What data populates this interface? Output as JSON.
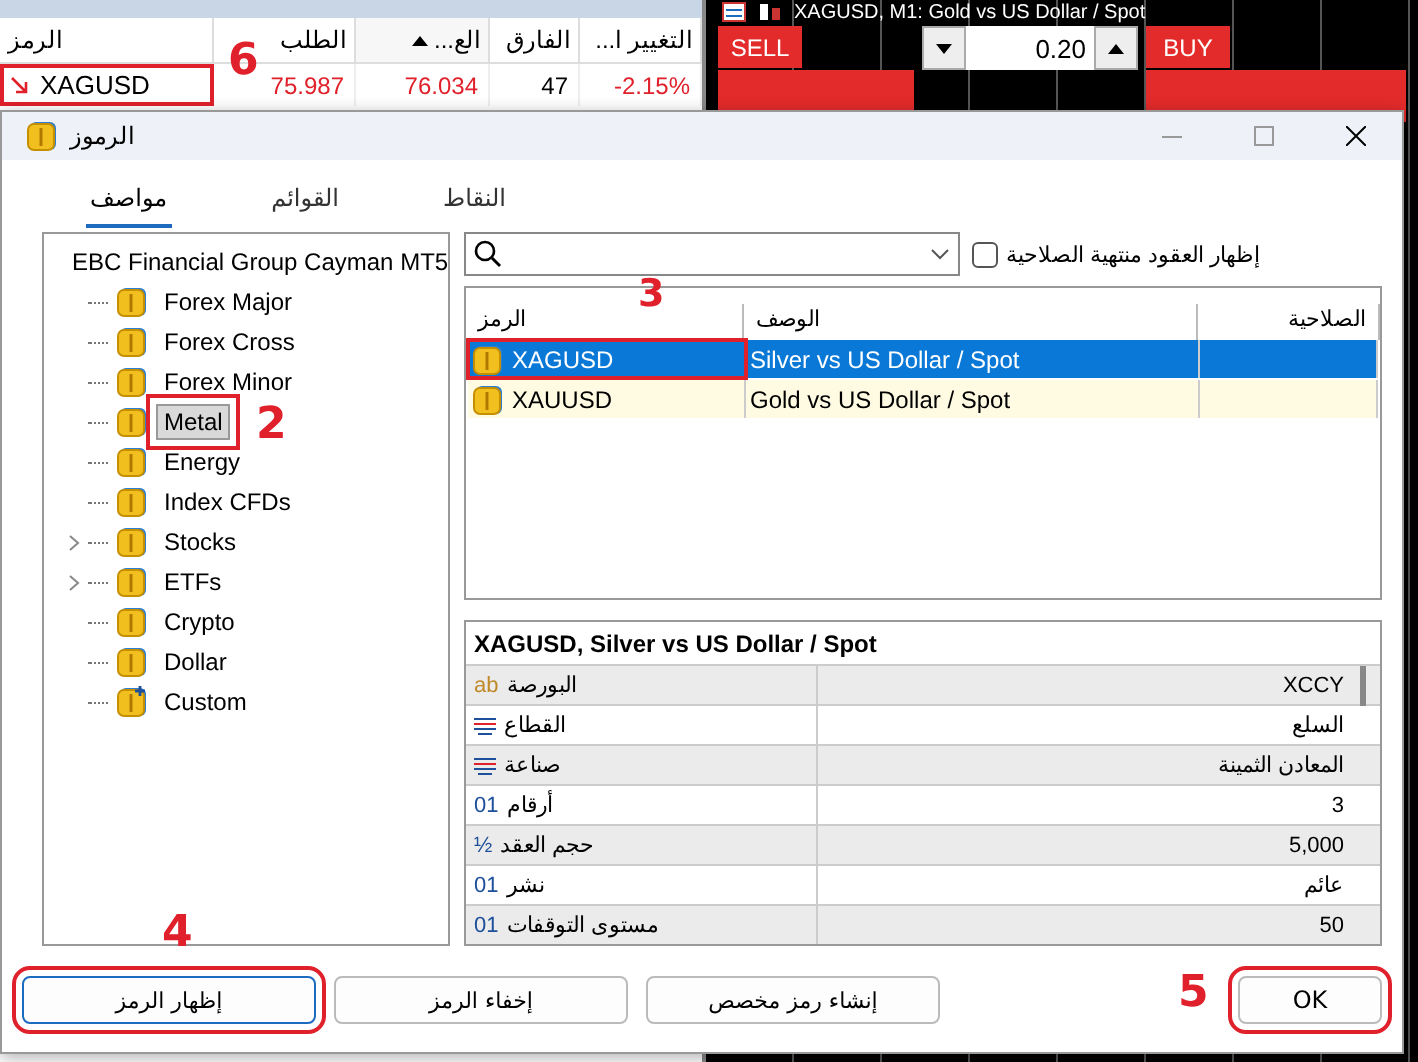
{
  "market_watch": {
    "columns": [
      {
        "label": "...التغيير ا",
        "sorted": false
      },
      {
        "label": "الفارق",
        "sorted": false
      },
      {
        "label": "...الع",
        "sorted": true
      },
      {
        "label": "الطلب",
        "sorted": false
      },
      {
        "label": "الرمز",
        "sorted": false
      }
    ],
    "rows": [
      {
        "symbol": "XAGUSD",
        "falling": true,
        "bid": "75.987",
        "ask": "76.034",
        "spread": "47",
        "change": "-2.15%",
        "callout": "6"
      }
    ]
  },
  "chart": {
    "title": "XAGUSD, M1:  Gold vs US Dollar / Spot",
    "sell": "SELL",
    "buy": "BUY",
    "volume": "0.20"
  },
  "dialog": {
    "title": "الرموز",
    "tabs": [
      {
        "label": "النقاط",
        "selected": false
      },
      {
        "label": "القوائم",
        "selected": false
      },
      {
        "label": "مواصف",
        "selected": true
      }
    ],
    "tree": {
      "label": "EBC Financial Group Cayman MT5",
      "children": [
        {
          "label": "Forex Major",
          "kind": "symbol",
          "collapsed": false,
          "selected": false
        },
        {
          "label": "Forex Cross",
          "kind": "symbol",
          "collapsed": false,
          "selected": false
        },
        {
          "label": "Forex Minor",
          "kind": "symbol",
          "collapsed": false,
          "selected": false
        },
        {
          "label": "Metal",
          "kind": "symbol",
          "collapsed": false,
          "selected": true,
          "callout": "2"
        },
        {
          "label": "Energy",
          "kind": "symbol",
          "collapsed": false,
          "selected": false
        },
        {
          "label": "Index CFDs",
          "kind": "symbol",
          "collapsed": false,
          "selected": false
        },
        {
          "label": "Stocks",
          "kind": "symbol",
          "collapsed": true,
          "selected": false
        },
        {
          "label": "ETFs",
          "kind": "symbol",
          "collapsed": true,
          "selected": false
        },
        {
          "label": "Crypto",
          "kind": "symbol",
          "collapsed": false,
          "selected": false
        },
        {
          "label": "Dollar",
          "kind": "symbol",
          "collapsed": false,
          "selected": false
        },
        {
          "label": "Custom",
          "kind": "custom",
          "collapsed": false,
          "selected": false
        }
      ]
    },
    "expired_checkbox": {
      "label": "إظهار العقود منتهية الصلاحية",
      "checked": false
    },
    "table": {
      "columns": [
        "الصلاحية",
        "الوصف",
        "الرمز"
      ],
      "callout": "3",
      "rows": [
        {
          "symbol": "XAGUSD",
          "description": "Silver vs US Dollar / Spot",
          "selected": true,
          "highlighted": true
        },
        {
          "symbol": "XAUUSD",
          "description": "Gold vs US Dollar / Spot",
          "selected": false,
          "highlighted": false
        }
      ]
    },
    "details": {
      "title": "XAGUSD, Silver vs US Dollar / Spot",
      "rows": [
        {
          "kind": "glyph",
          "glyph": "ab",
          "label": "البورصة",
          "value": "XCCY"
        },
        {
          "kind": "lines",
          "label": "القطاع",
          "value": "السلع"
        },
        {
          "kind": "lines",
          "label": "صناعة",
          "value": "المعادن الثمينة"
        },
        {
          "kind": "glyph",
          "glyph": "01",
          "label": "أرقام",
          "value": "3"
        },
        {
          "kind": "glyph",
          "glyph": "½",
          "label": "حجم العقد",
          "value": "5,000"
        },
        {
          "kind": "glyph",
          "glyph": "01",
          "label": "نشر",
          "value": "عائم"
        },
        {
          "kind": "glyph",
          "glyph": "01",
          "label": "مستوى التوقفات",
          "value": "50"
        }
      ]
    },
    "buttons": [
      {
        "label": "إنشاء رمز مخصص",
        "focused": false
      },
      {
        "label": "إخفاء الرمز",
        "focused": false
      },
      {
        "label": "إظهار الرمز",
        "focused": true,
        "callout": "4"
      }
    ],
    "ok_button": {
      "label": "OK",
      "callout": "5"
    }
  }
}
